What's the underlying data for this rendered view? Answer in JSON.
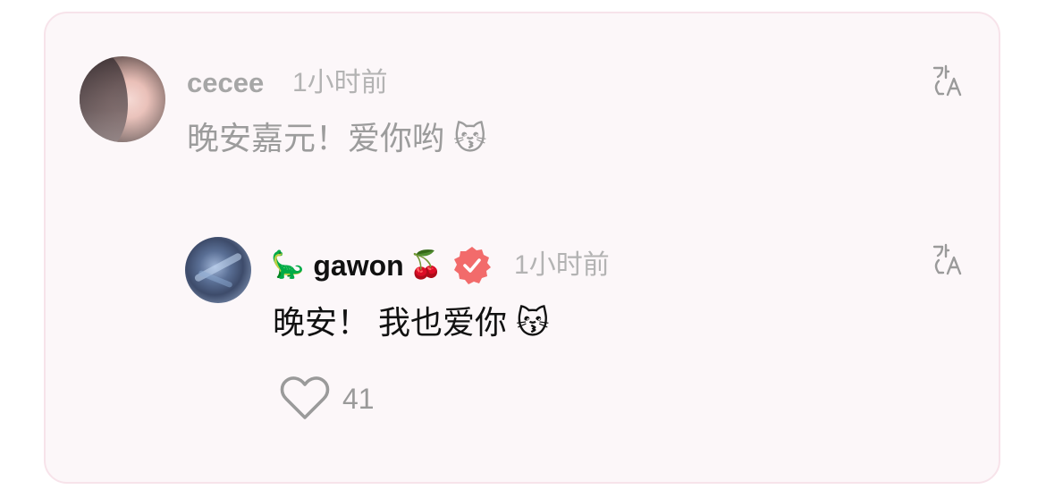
{
  "parent_comment": {
    "username": "cecee",
    "time": "1小时前",
    "text": "晚安嘉元！爱你哟 😽"
  },
  "reply_comment": {
    "username_prefix_emoji": "🦕",
    "username": "gawon",
    "username_suffix_emoji": "🍒",
    "verified_icon": "verified-badge-icon",
    "time": "1小时前",
    "text": "晚安！ 我也爱你 😽",
    "likes": "41"
  },
  "icons": {
    "translate": "translate-icon",
    "like": "heart-outline-icon"
  },
  "colors": {
    "card_background": "#fcf7f9",
    "card_border": "#f7e3ea",
    "verified_badge": "#f26b6b",
    "muted_text": "#a6a6a6"
  }
}
